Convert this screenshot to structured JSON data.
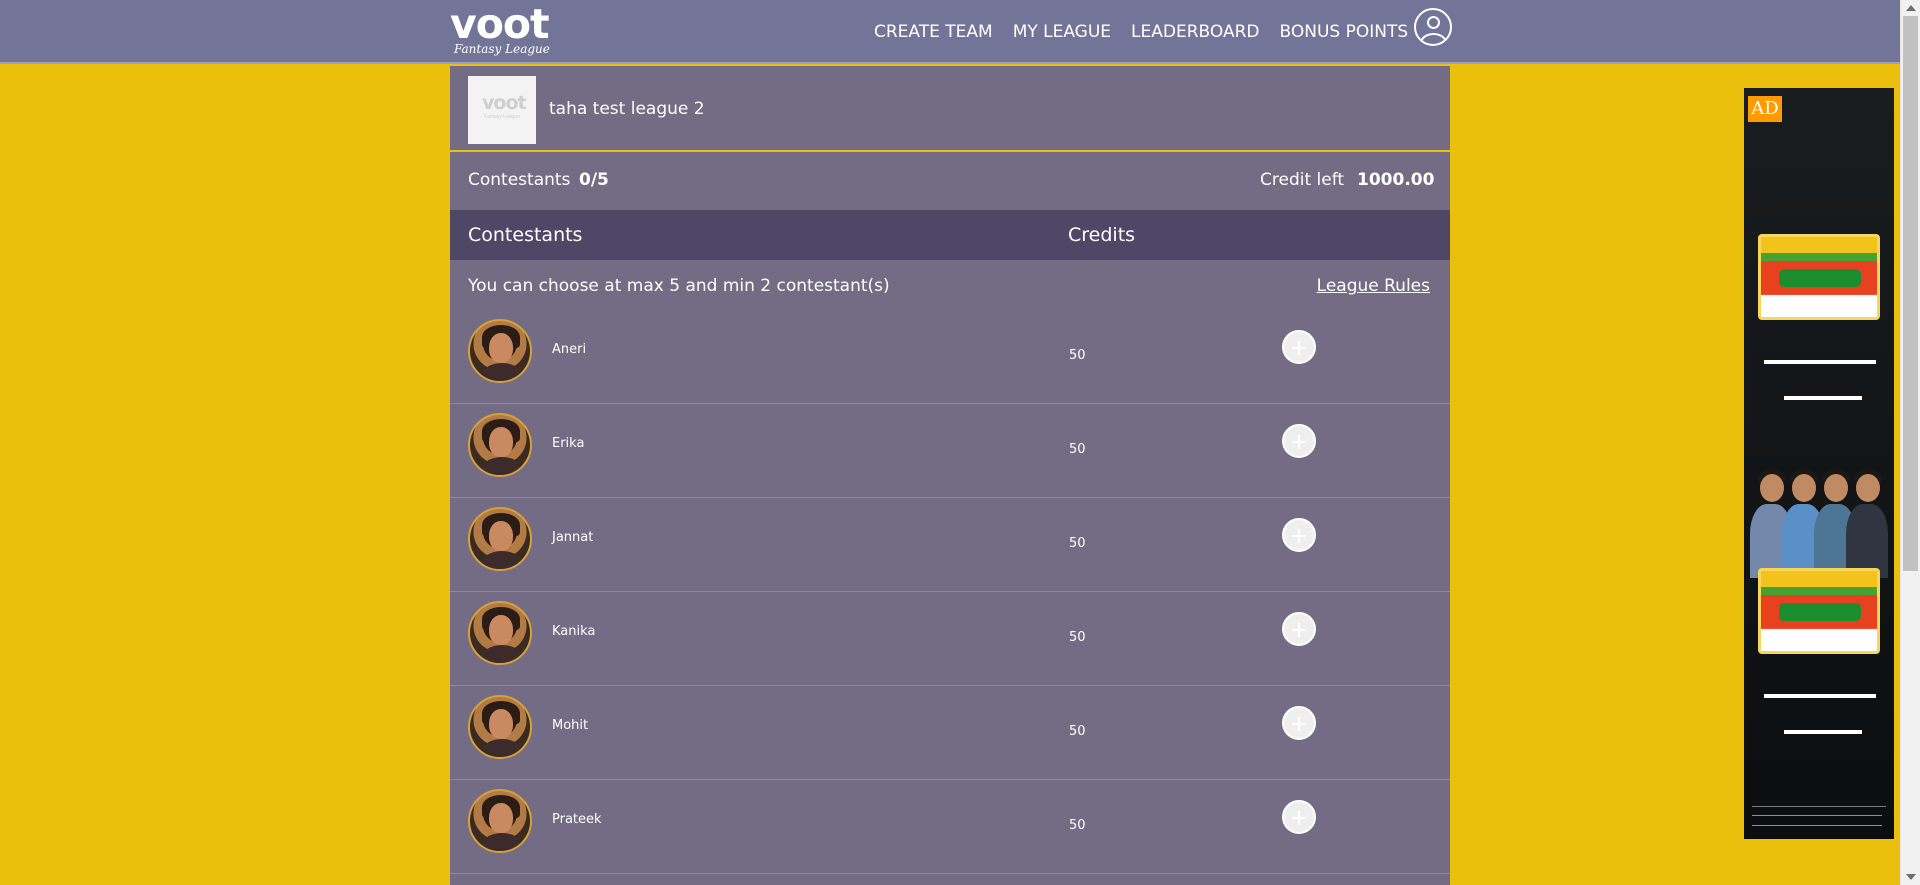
{
  "header": {
    "logo_word": "voot",
    "logo_sub": "Fantasy League",
    "nav": [
      "CREATE TEAM",
      "MY LEAGUE",
      "LEADERBOARD",
      "BONUS POINTS"
    ]
  },
  "league": {
    "thumb_text": "voot",
    "thumb_sub": "Fantasy League",
    "name": "taha test league 2"
  },
  "summary": {
    "contestants_label": "Contestants",
    "contestants_value": "0/5",
    "credit_label": "Credit left",
    "credit_value": "1000.00"
  },
  "table": {
    "col_contestants": "Contestants",
    "col_credits": "Credits",
    "instruction": "You can choose at max 5 and min 2 contestant(s)",
    "rules_link": "League Rules",
    "rows": [
      {
        "name": "Aneri",
        "credits": "50"
      },
      {
        "name": "Erika",
        "credits": "50"
      },
      {
        "name": "Jannat",
        "credits": "50"
      },
      {
        "name": "Kanika",
        "credits": "50"
      },
      {
        "name": "Mohit",
        "credits": "50"
      },
      {
        "name": "Prateek",
        "credits": "50"
      }
    ]
  },
  "ad": {
    "badge": "AD"
  }
}
